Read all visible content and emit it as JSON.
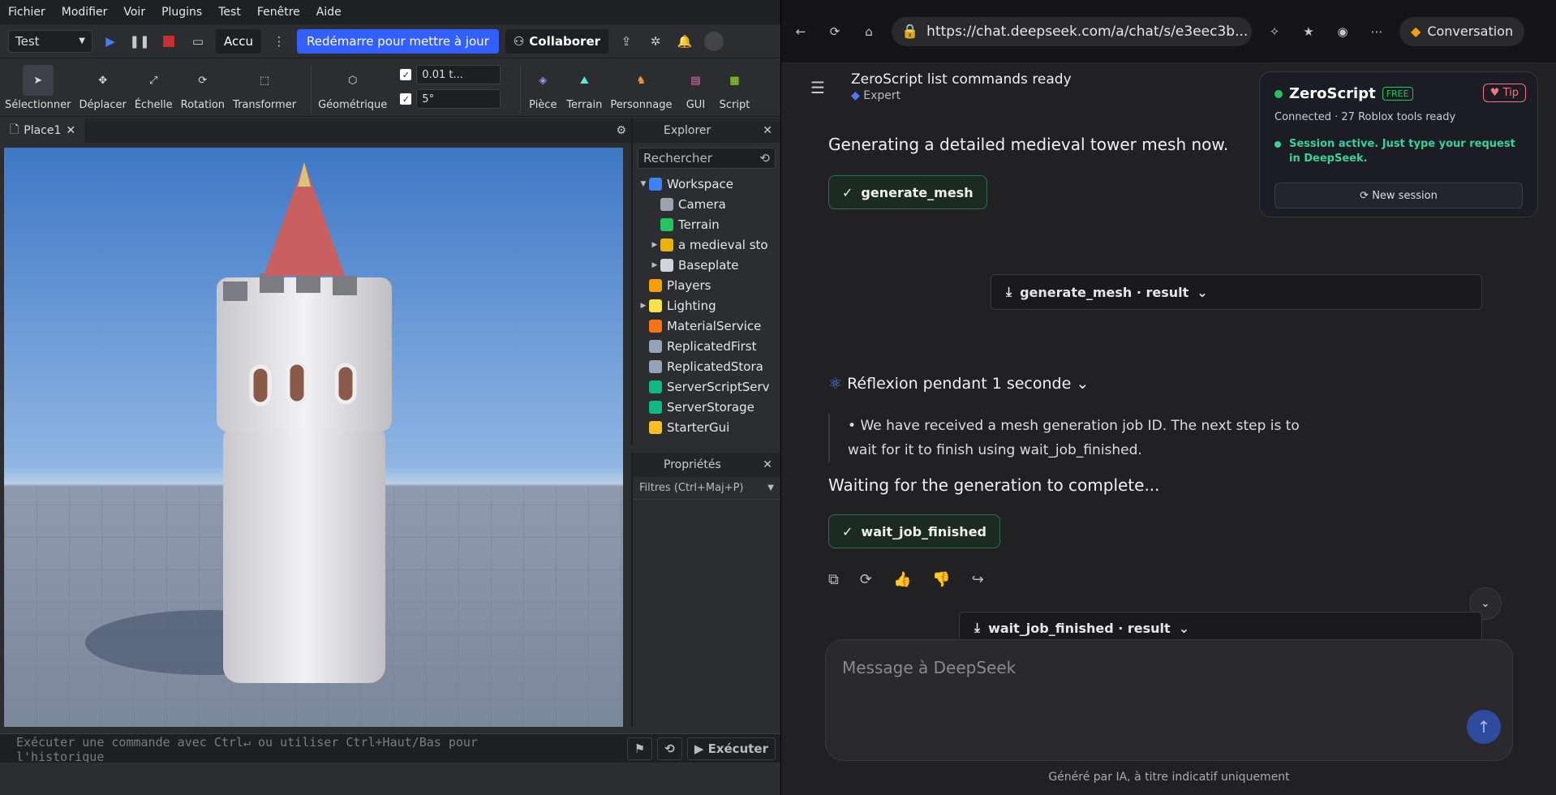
{
  "studio": {
    "menu": [
      "Fichier",
      "Modifier",
      "Voir",
      "Plugins",
      "Test",
      "Fenêtre",
      "Aide"
    ],
    "mode_select": "Test",
    "accu_label": "Accu",
    "restart_label": "Redémarre pour mettre à jour",
    "collab_label": "Collaborer",
    "tools": [
      "Sélectionner",
      "Déplacer",
      "Échelle",
      "Rotation",
      "Transformer"
    ],
    "geo_label": "Géométrique",
    "move_step": "0.01 t...",
    "rot_step": "5°",
    "insert_tools": [
      "Pièce",
      "Terrain",
      "Personnage",
      "GUI",
      "Script"
    ],
    "tab_label": "Place1",
    "explorer_title": "Explorer",
    "search_placeholder": "Rechercher",
    "tree": [
      {
        "label": "Workspace",
        "arrow": "▼",
        "indent": 0,
        "color": "#3b82f6"
      },
      {
        "label": "Camera",
        "arrow": "",
        "indent": 1,
        "color": "#9ca3af"
      },
      {
        "label": "Terrain",
        "arrow": "",
        "indent": 1,
        "color": "#22c55e"
      },
      {
        "label": "a medieval sto",
        "arrow": "▶",
        "indent": 1,
        "color": "#eab308"
      },
      {
        "label": "Baseplate",
        "arrow": "▶",
        "indent": 1,
        "color": "#d1d5db"
      },
      {
        "label": "Players",
        "arrow": "",
        "indent": 0,
        "color": "#f59e0b"
      },
      {
        "label": "Lighting",
        "arrow": "▶",
        "indent": 0,
        "color": "#fde047"
      },
      {
        "label": "MaterialService",
        "arrow": "",
        "indent": 0,
        "color": "#f97316"
      },
      {
        "label": "ReplicatedFirst",
        "arrow": "",
        "indent": 0,
        "color": "#94a3b8"
      },
      {
        "label": "ReplicatedStora",
        "arrow": "",
        "indent": 0,
        "color": "#94a3b8"
      },
      {
        "label": "ServerScriptServ",
        "arrow": "",
        "indent": 0,
        "color": "#10b981"
      },
      {
        "label": "ServerStorage",
        "arrow": "",
        "indent": 0,
        "color": "#10b981"
      },
      {
        "label": "StarterGui",
        "arrow": "",
        "indent": 0,
        "color": "#fbbf24"
      }
    ],
    "props_title": "Propriétés",
    "props_filter": "Filtres (Ctrl+Maj+P)",
    "cmd_placeholder": "Exécuter une commande avec Ctrl↵ ou utiliser Ctrl+Haut/Bas pour",
    "cmd_placeholder2": "l'historique",
    "execute_label": "Exécuter"
  },
  "browser": {
    "url": "https://chat.deepseek.com/a/chat/s/e3eec3b...",
    "conversation_label": "Conversation",
    "chat_title": "ZeroScript list commands ready",
    "chat_mode": "Expert",
    "msg1": "Generating a detailed medieval tower mesh now.",
    "tool1": "generate_mesh",
    "result1": "generate_mesh · result",
    "thinking": "Réflexion pendant 1 seconde",
    "bullet": "We have received a mesh generation job ID. The next step is to wait for it to finish using wait_job_finished.",
    "msg2": "Waiting for the generation to complete...",
    "tool2": "wait_job_finished",
    "result2": "wait_job_finished · result",
    "composer_placeholder": "Message à DeepSeek",
    "footer": "Généré par IA, à titre indicatif uniquement",
    "card": {
      "name": "ZeroScript",
      "badge": "FREE",
      "tip": "♥ Tip",
      "status": "Connected · 27 Roblox tools ready",
      "session": "Session active. Just type your request in DeepSeek.",
      "new_session": "⟳ New session"
    }
  }
}
